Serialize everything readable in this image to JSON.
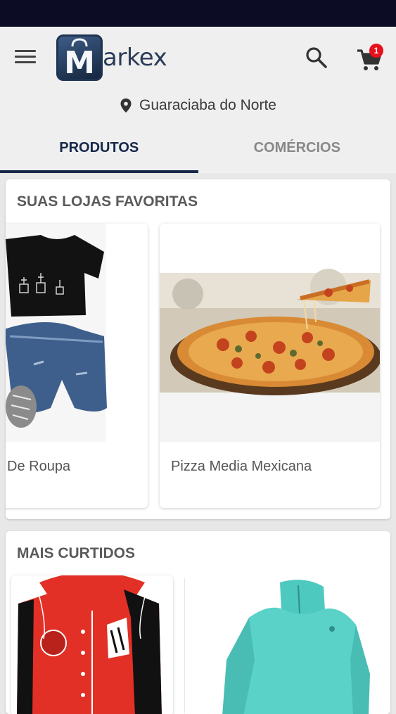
{
  "app": {
    "logo_text": "arkex",
    "logo_letter": "M",
    "cart_count": "1"
  },
  "location": {
    "city": "Guaraciaba do Norte"
  },
  "tabs": [
    {
      "label": "PRODUTOS",
      "active": true
    },
    {
      "label": "COMÉRCIOS",
      "active": false
    }
  ],
  "favorites": {
    "title": "SUAS LOJAS FAVORITAS",
    "stores": [
      {
        "name": "De Roupa"
      },
      {
        "name": "Pizza Media Mexicana"
      }
    ]
  },
  "most_liked": {
    "title": "MAIS CURTIDOS"
  },
  "colors": {
    "brand": "#15284a",
    "status_bar": "#0c0c24",
    "badge": "#e8101c"
  }
}
